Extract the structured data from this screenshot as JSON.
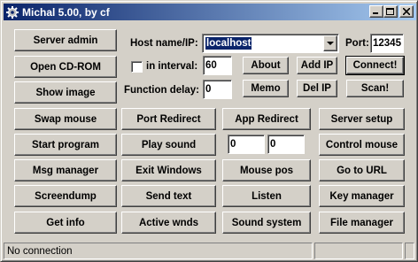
{
  "window": {
    "title": "Michal 5.00, by cf",
    "icons": {
      "app": "gear-icon",
      "minimize": "minimize-icon",
      "maximize": "maximize-icon",
      "close": "close-icon"
    }
  },
  "connection": {
    "host_label": "Host name/IP:",
    "host_value": "localhost",
    "port_label": "Port:",
    "port_value": "12345",
    "interval_label": "in interval:",
    "interval_checked": false,
    "interval_value": "60",
    "delay_label": "Function delay:",
    "delay_value": "0"
  },
  "buttons": {
    "server_admin": "Server admin",
    "open_cdrom": "Open CD-ROM",
    "show_image": "Show image",
    "about": "About",
    "add_ip": "Add IP",
    "connect": "Connect!",
    "memo": "Memo",
    "del_ip": "Del IP",
    "scan": "Scan!",
    "swap_mouse": "Swap mouse",
    "port_redirect": "Port Redirect",
    "app_redirect": "App Redirect",
    "server_setup": "Server setup",
    "start_program": "Start program",
    "play_sound": "Play sound",
    "control_mouse": "Control mouse",
    "msg_manager": "Msg manager",
    "exit_windows": "Exit Windows",
    "mouse_pos": "Mouse pos",
    "go_to_url": "Go to URL",
    "screendump": "Screendump",
    "send_text": "Send text",
    "listen": "Listen",
    "key_manager": "Key manager",
    "get_info": "Get info",
    "active_wnds": "Active wnds",
    "sound_system": "Sound system",
    "file_manager": "File manager"
  },
  "coords": {
    "x": "0",
    "y": "0"
  },
  "status": {
    "text": "No connection",
    "panel2": "",
    "panel3": ""
  }
}
